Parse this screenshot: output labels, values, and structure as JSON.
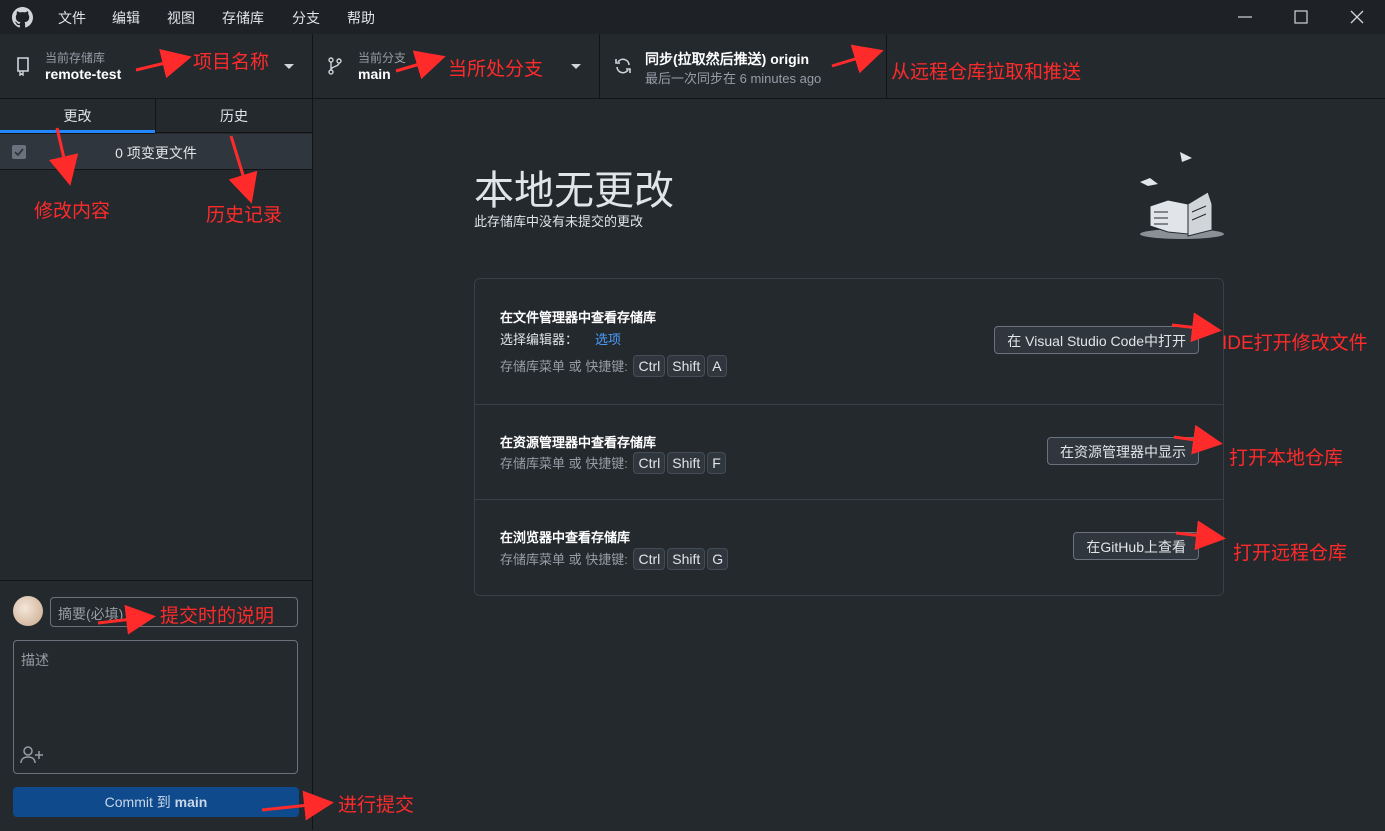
{
  "menu": {
    "items": [
      "文件",
      "编辑",
      "视图",
      "存储库",
      "分支",
      "帮助"
    ]
  },
  "toolbar": {
    "repo_label": "当前存储库",
    "repo_name": "remote-test",
    "branch_label": "当前分支",
    "branch_name": "main",
    "sync_title": "同步(拉取然后推送) origin",
    "sync_subtitle": "最后一次同步在 6 minutes ago"
  },
  "sidebar": {
    "tabs": [
      "更改",
      "历史"
    ],
    "changes_count": "0 项变更文件",
    "summary_placeholder": "摘要(必填)",
    "description_placeholder": "描述",
    "commit_prefix": "Commit 到 ",
    "commit_branch": "main"
  },
  "main": {
    "title": "本地无更改",
    "subtitle": "此存储库中没有未提交的更改",
    "actions": [
      {
        "title": "在文件管理器中查看存储库",
        "editor_label": "选择编辑器：",
        "editor_link": "选项",
        "shortcut_text": "存储库菜单 或 快捷键:",
        "keys": [
          "Ctrl",
          "Shift",
          "A"
        ],
        "button": "在 Visual Studio Code中打开"
      },
      {
        "title": "在资源管理器中查看存储库",
        "shortcut_text": "存储库菜单 或 快捷键:",
        "keys": [
          "Ctrl",
          "Shift",
          "F"
        ],
        "button": "在资源管理器中显示"
      },
      {
        "title": "在浏览器中查看存储库",
        "shortcut_text": "存储库菜单 或 快捷键:",
        "keys": [
          "Ctrl",
          "Shift",
          "G"
        ],
        "button": "在GitHub上查看"
      }
    ]
  },
  "annotations": {
    "project_name": "项目名称",
    "current_branch": "当所处分支",
    "sync": "从远程仓库拉取和推送",
    "changes": "修改内容",
    "history": "历史记录",
    "ide": "IDE打开修改文件",
    "local_repo": "打开本地仓库",
    "remote_repo": "打开远程仓库",
    "commit_desc": "提交时的说明",
    "commit": "进行提交"
  },
  "colors": {
    "accent": "#2188ff",
    "annotation": "#ff2a2a",
    "commit_button": "#0f4a8c",
    "link": "#4a9eff"
  }
}
